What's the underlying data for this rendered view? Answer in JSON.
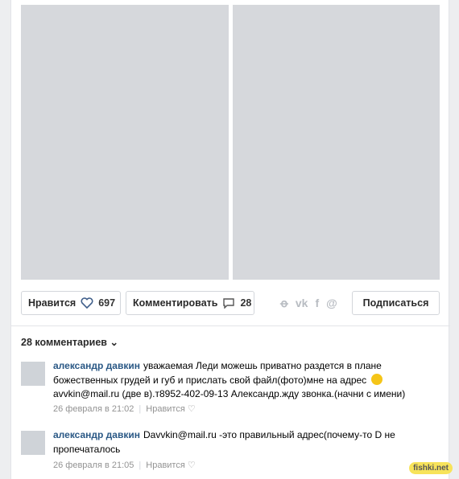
{
  "post": {
    "photo_left_label": "",
    "photo_right_label": ""
  },
  "actions": {
    "like_label": "Нравится",
    "like_count": "697",
    "comment_label": "Комментировать",
    "comment_count": "28",
    "share_icons": [
      "odnoklassniki-icon",
      "vk-icon",
      "facebook-icon",
      "mail-icon"
    ],
    "subscribe_label": "Подписаться"
  },
  "comments": {
    "count_label": "28 комментариев",
    "items": [
      {
        "author": "александр давкин",
        "text": "уважаемая Леди можешь приватно раздется в плане божественных грудей и губ и прислать свой файл(фото)мне на адрес",
        "text2": "avvkin@mail.ru (две в).т8952-402-09-13 Александр.жду звонка.(начни с имени)",
        "date": "26 февраля в 21:02",
        "like_label": "Нравится"
      },
      {
        "author": "александр давкин",
        "text": "Davvkin@mail.ru -это правильный адрес(почему-то D не пропечаталось",
        "date": "26 февраля в 21:05",
        "like_label": "Нравится"
      }
    ]
  },
  "watermark": "fishki.net"
}
